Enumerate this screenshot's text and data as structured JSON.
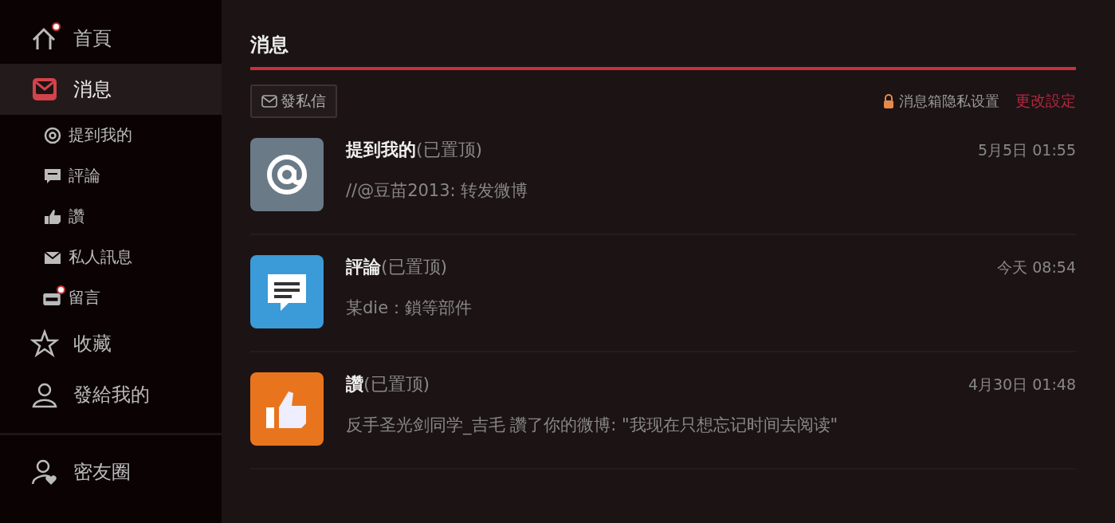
{
  "sidebar": {
    "items": [
      {
        "label": "首頁",
        "kind": "home",
        "selected": false,
        "badge": true
      },
      {
        "label": "消息",
        "kind": "inbox",
        "selected": true,
        "badge": false,
        "children": [
          {
            "label": "提到我的",
            "kind": "at",
            "selected": false,
            "badge": false
          },
          {
            "label": "評論",
            "kind": "comment",
            "selected": false,
            "badge": false
          },
          {
            "label": "讚",
            "kind": "like",
            "selected": false,
            "badge": false
          },
          {
            "label": "私人訊息",
            "kind": "mail",
            "selected": false,
            "badge": false
          },
          {
            "label": "留言",
            "kind": "board",
            "selected": false,
            "badge": true
          }
        ]
      },
      {
        "label": "收藏",
        "kind": "star",
        "selected": false,
        "badge": false
      },
      {
        "label": "發給我的",
        "kind": "person",
        "selected": false,
        "badge": false
      }
    ],
    "footer_items": [
      {
        "label": "密友圈",
        "kind": "friends",
        "selected": false,
        "badge": false
      }
    ]
  },
  "main": {
    "title": "消息",
    "compose_button": "發私信",
    "privacy_label": "消息箱隐私设置",
    "privacy_link": "更改設定",
    "messages": [
      {
        "kind": "mention",
        "title": "提到我的",
        "tag": "(已置顶)",
        "time": "5月5日 01:55",
        "preview": "//@豆苗2013: 转发微博"
      },
      {
        "kind": "comment",
        "title": "評論",
        "tag": "(已置顶)",
        "time": "今天 08:54",
        "preview": "某die：鎖等部件"
      },
      {
        "kind": "like",
        "title": "讚",
        "tag": "(已置顶)",
        "time": "4月30日 01:48",
        "preview": "反手圣光剑同学_吉毛 讚了你的微博: \"我现在只想忘记时间去阅读\""
      }
    ]
  }
}
